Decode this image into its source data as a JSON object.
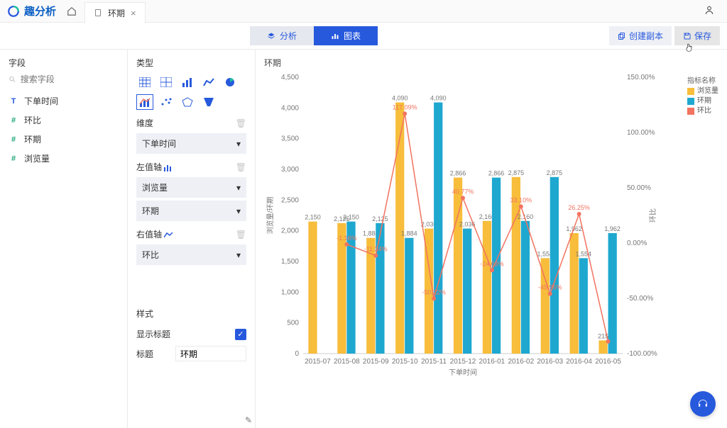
{
  "app": {
    "name": "趣分析",
    "tab_title": "环期"
  },
  "actions": {
    "analyze": "分析",
    "chart": "图表",
    "copy": "创建副本",
    "save": "保存"
  },
  "fields": {
    "title": "字段",
    "search_placeholder": "搜索字段",
    "items": [
      {
        "type": "T",
        "label": "下单时间"
      },
      {
        "type": "#",
        "label": "环比"
      },
      {
        "type": "#",
        "label": "环期"
      },
      {
        "type": "#",
        "label": "浏览量"
      }
    ]
  },
  "config": {
    "type_label": "类型",
    "dimension_label": "维度",
    "dimension_value": "下单时间",
    "left_axis_label": "左值轴",
    "left_axis_values": [
      "浏览量",
      "环期"
    ],
    "right_axis_label": "右值轴",
    "right_axis_values": [
      "环比"
    ],
    "style_label": "样式",
    "show_title_label": "显示标题",
    "title_label": "标题",
    "title_value": "环期"
  },
  "chart": {
    "title": "环期",
    "legend_title": "指标名称",
    "legend": [
      {
        "name": "浏览量",
        "color": "#f7bd3b"
      },
      {
        "name": "环期",
        "color": "#1ea8d0"
      },
      {
        "name": "环比",
        "color": "#f27360"
      }
    ],
    "y1_label": "浏览量/环期",
    "y2_label": "环比",
    "x_label": "下单时间"
  },
  "chart_data": {
    "type": "bar",
    "categories": [
      "2015-07",
      "2015-08",
      "2015-09",
      "2015-10",
      "2015-11",
      "2015-12",
      "2016-01",
      "2016-02",
      "2016-03",
      "2016-04",
      "2016-05"
    ],
    "series": [
      {
        "name": "浏览量",
        "values": [
          2150,
          2125,
          1884,
          4090,
          2036,
          2866,
          2160,
          2875,
          1554,
          1962,
          215
        ],
        "color": "#f7bd3b",
        "axis": "left",
        "kind": "bar"
      },
      {
        "name": "环期",
        "values": [
          null,
          2150,
          2125,
          1884,
          4090,
          2036,
          2866,
          2160,
          2875,
          1554,
          1962
        ],
        "color": "#1ea8d0",
        "axis": "left",
        "kind": "bar"
      },
      {
        "name": "环比",
        "values": [
          null,
          -1.16,
          -11.34,
          117.09,
          -50.22,
          40.77,
          -24.63,
          33.1,
          -45.95,
          26.25,
          -89.04
        ],
        "color": "#f27360",
        "axis": "right",
        "kind": "line",
        "labels": [
          null,
          "-1.16%",
          "-11.34%",
          "117.09%",
          "-50.22%",
          "40.77%",
          "-24.63%",
          "33.10%",
          "-45.95%",
          "26.25%",
          null
        ]
      }
    ],
    "bar_labels": [
      [
        2150,
        2125,
        1884,
        4090,
        2036,
        2866,
        2160,
        2875,
        1554,
        1962,
        215
      ],
      [
        null,
        2150,
        2125,
        1884,
        4090,
        2036,
        2866,
        2160,
        2875,
        1554,
        1962
      ]
    ],
    "y1": {
      "min": 0,
      "max": 4500,
      "step": 500
    },
    "y2": {
      "min": -100,
      "max": 150,
      "step": 50,
      "fmt": "%"
    },
    "xlabel": "下单时间",
    "y1label": "浏览量/环期",
    "y2label": "环比"
  }
}
